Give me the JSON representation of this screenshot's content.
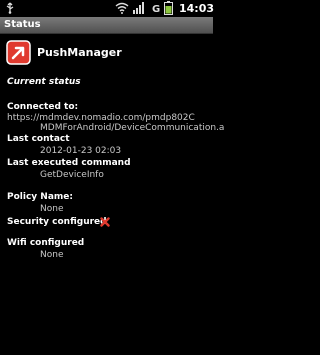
{
  "status_bar": {
    "time": "14:03",
    "network_label": "G"
  },
  "window": {
    "title": "Status"
  },
  "app": {
    "name": "PushManager"
  },
  "section": {
    "title": "Current status"
  },
  "fields": {
    "connected_to_label": "Connected to:",
    "connected_to_line1": "https://mdmdev.nomadio.com/pmdp802C",
    "connected_to_line2": "MDMForAndroid/DeviceCommunication.a",
    "last_contact_label": "Last contact",
    "last_contact_value": "2012-01-23 02:03",
    "last_command_label": "Last executed command",
    "last_command_value": "GetDeviceInfo",
    "policy_name_label": "Policy Name:",
    "policy_name_value": "None",
    "security_label": "Security configured",
    "wifi_label": "Wifi configured",
    "wifi_value": "None"
  },
  "colors": {
    "accent_red": "#e03a2f",
    "value_gray": "#c8c8c8"
  }
}
